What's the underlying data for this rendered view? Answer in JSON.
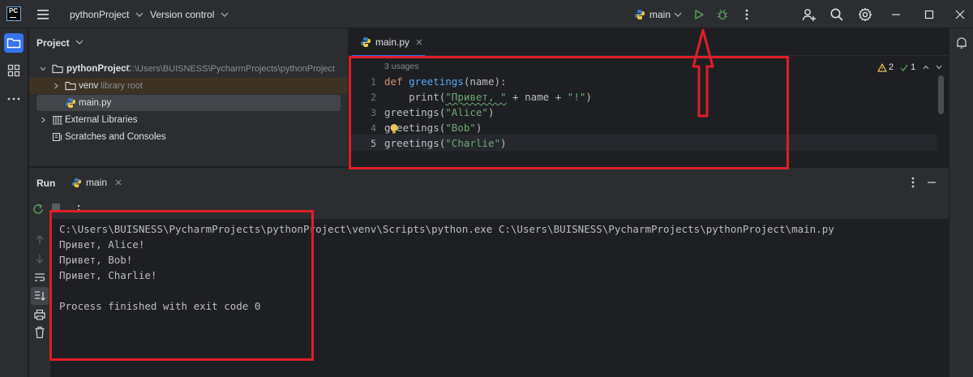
{
  "titlebar": {
    "logo_text": "PC",
    "project_name": "pythonProject",
    "vcs_label": "Version control",
    "run_config": "main"
  },
  "project_panel": {
    "title": "Project",
    "root_name": "pythonProject",
    "root_path": "C:\\Users\\BUISNESS\\PycharmProjects\\pythonProject",
    "venv_name": "venv",
    "venv_tag": "library root",
    "file_name": "main.py",
    "external_libraries": "External Libraries",
    "scratches": "Scratches and Consoles"
  },
  "editor": {
    "tab_name": "main.py",
    "usages": "3 usages",
    "warnings_count": "2",
    "checks_count": "1",
    "line_numbers": [
      "1",
      "2",
      "3",
      "4",
      "5"
    ],
    "code": {
      "l1_kw": "def",
      "l1_fn": "greetings",
      "l1_rest": "(name):",
      "l2_indent": "    print(",
      "l2_str1": "\"Привет, \"",
      "l2_mid": " + name + ",
      "l2_str2": "\"!\"",
      "l2_end": ")",
      "l3_a": "greetings(",
      "l3_str": "\"Alice\"",
      "l3_b": ")",
      "l4_a": "greetings(",
      "l4_str": "\"Bob\"",
      "l4_b": ")",
      "l5_a": "greetings(",
      "l5_str": "\"Charlie\"",
      "l5_b": ")"
    }
  },
  "run_panel": {
    "title": "Run",
    "tab_name": "main",
    "output": [
      "C:\\Users\\BUISNESS\\PycharmProjects\\pythonProject\\venv\\Scripts\\python.exe C:\\Users\\BUISNESS\\PycharmProjects\\pythonProject\\main.py",
      "Привет, Alice!",
      "Привет, Bob!",
      "Привет, Charlie!",
      "",
      "Process finished with exit code 0"
    ]
  },
  "colors": {
    "accent": "#3574f0",
    "run_green": "#57965c",
    "annotation_red": "#e01e28"
  }
}
